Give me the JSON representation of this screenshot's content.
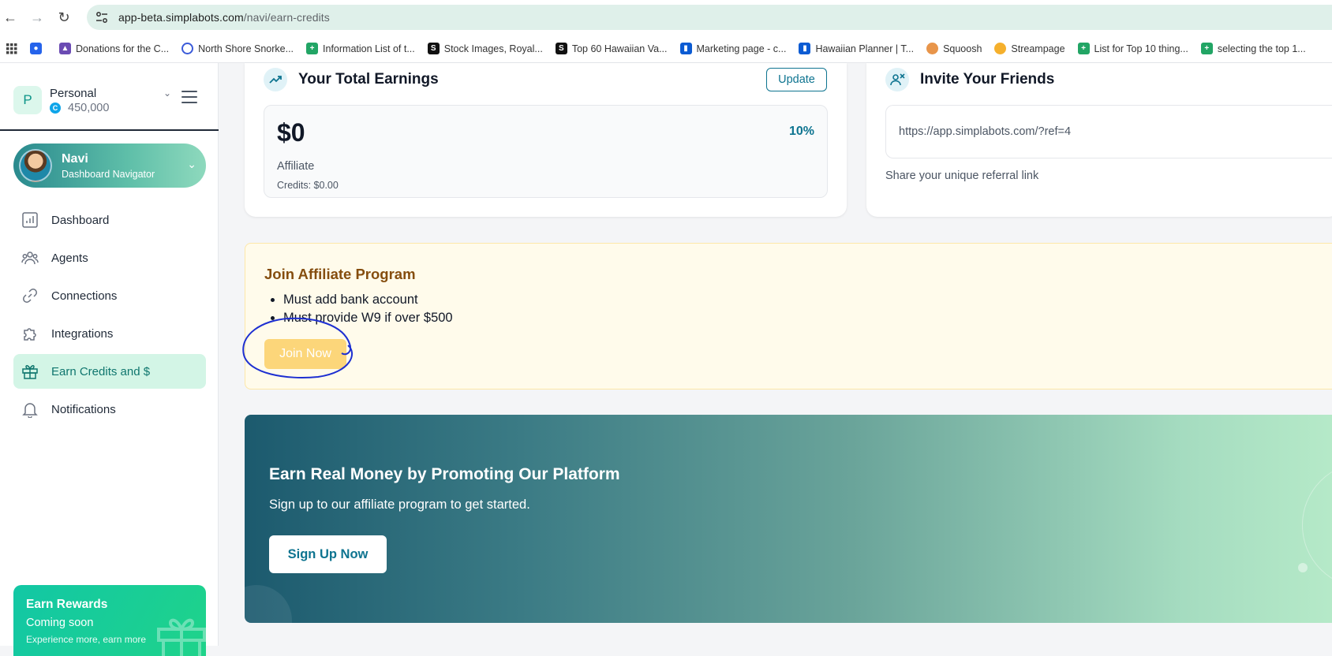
{
  "browser": {
    "url_host": "app-beta.simplabots.com",
    "url_path": "/navi/earn-credits",
    "bookmarks": [
      {
        "label": "",
        "icon": "apps-grid-icon"
      },
      {
        "label": "",
        "icon": "blue-square-icon"
      },
      {
        "label": "Donations for the C...",
        "icon": "donate-icon"
      },
      {
        "label": "North Shore Snorke...",
        "icon": "globe-icon"
      },
      {
        "label": "Information List of t...",
        "icon": "sheets-icon"
      },
      {
        "label": "Stock Images, Royal...",
        "icon": "stock-icon"
      },
      {
        "label": "Top 60 Hawaiian Va...",
        "icon": "stock-icon"
      },
      {
        "label": "Marketing page - c...",
        "icon": "trello-icon"
      },
      {
        "label": "Hawaiian Planner | T...",
        "icon": "trello-icon"
      },
      {
        "label": "Squoosh",
        "icon": "squoosh-icon"
      },
      {
        "label": "Streampage",
        "icon": "streampage-icon"
      },
      {
        "label": "List for Top 10 thing...",
        "icon": "sheets-icon"
      },
      {
        "label": "selecting the  top 1...",
        "icon": "sheets-icon"
      }
    ]
  },
  "account": {
    "initial": "P",
    "name": "Personal",
    "credits": "450,000",
    "coin_glyph": "C"
  },
  "agent": {
    "name": "Navi",
    "role": "Dashboard Navigator"
  },
  "menu": [
    {
      "label": "Dashboard",
      "icon": "chart-icon",
      "active": false
    },
    {
      "label": "Agents",
      "icon": "users-icon",
      "active": false
    },
    {
      "label": "Connections",
      "icon": "link-icon",
      "active": false
    },
    {
      "label": "Integrations",
      "icon": "puzzle-icon",
      "active": false
    },
    {
      "label": "Earn Credits and $",
      "icon": "gift-icon",
      "active": true
    },
    {
      "label": "Notifications",
      "icon": "bell-icon",
      "active": false
    }
  ],
  "rewards": {
    "title": "Earn Rewards",
    "subtitle": "Coming soon",
    "note": "Experience more, earn more"
  },
  "earnings": {
    "title": "Your Total Earnings",
    "update_label": "Update",
    "amount": "$0",
    "percent": "10%",
    "type": "Affiliate",
    "credits": "Credits: $0.00"
  },
  "invite": {
    "title": "Invite Your Friends",
    "link": "https://app.simplabots.com/?ref=4",
    "hint": "Share your unique referral link"
  },
  "affiliate": {
    "title": "Join Affiliate Program",
    "requirements": [
      "Must add bank account",
      "Must provide W9 if over $500"
    ],
    "join_label": "Join Now"
  },
  "promo": {
    "title": "Earn Real Money by Promoting Our Platform",
    "subtitle": "Sign up to our affiliate program to get started.",
    "button_label": "Sign Up Now"
  },
  "colors": {
    "accent": "#0e7490",
    "active_nav_bg": "#d3f5e6",
    "affiliate_bg": "#fffbeb",
    "join_button": "#fcd67a",
    "annotation": "#1d2fd1"
  }
}
